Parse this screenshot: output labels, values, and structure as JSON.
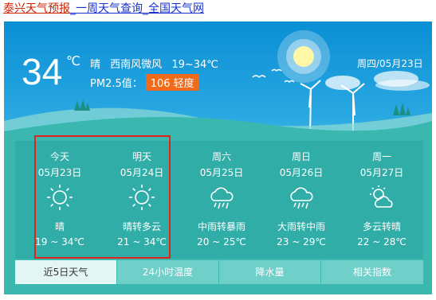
{
  "links": [
    "泰兴天气预报",
    "一周天气查询",
    "全国天气网"
  ],
  "current": {
    "temperature": "34",
    "unit": "℃",
    "condition": "晴",
    "wind": "西南风微风",
    "range": "19~34℃",
    "pm_label": "PM2.5值：",
    "pm_value": "106 轻度",
    "date": "周四/05月23日"
  },
  "forecast": [
    {
      "name": "今天",
      "date": "05月23日",
      "icon": "sun-icon",
      "desc": "晴",
      "temp": "19 ~ 34℃"
    },
    {
      "name": "明天",
      "date": "05月24日",
      "icon": "sun-icon",
      "desc": "晴转多云",
      "temp": "21 ~ 34℃"
    },
    {
      "name": "周六",
      "date": "05月25日",
      "icon": "rain-cloud-icon",
      "desc": "中雨转暴雨",
      "temp": "20 ~ 25℃"
    },
    {
      "name": "周日",
      "date": "05月26日",
      "icon": "rain-cloud-icon",
      "desc": "大雨转中雨",
      "temp": "23 ~ 29℃"
    },
    {
      "name": "周一",
      "date": "05月27日",
      "icon": "cloudy-sun-icon",
      "desc": "多云转晴",
      "temp": "22 ~ 28℃"
    }
  ],
  "tabs": [
    "近5日天气",
    "24小时温度",
    "降水量",
    "相关指数"
  ],
  "colors": {
    "pm_badge": "#f06a1a",
    "highlight_border": "#e2231a",
    "active_tab": "#e4f6f4"
  }
}
